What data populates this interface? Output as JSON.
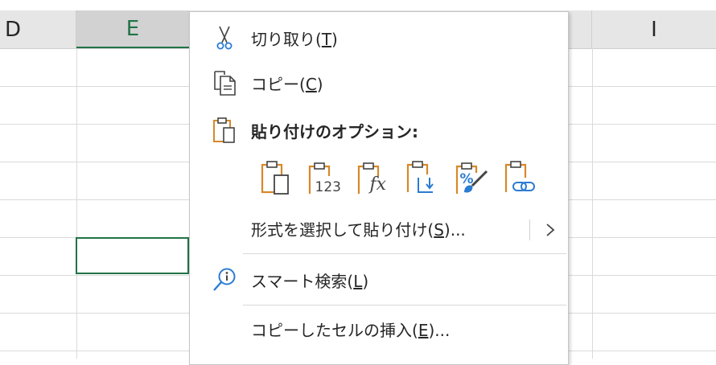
{
  "sheet": {
    "columns": [
      "D",
      "E",
      "",
      "",
      "I"
    ],
    "selected_column": "E"
  },
  "menu": {
    "cut": {
      "label_main": "切り取り(",
      "accel": "T",
      "label_end": ")"
    },
    "copy": {
      "label_main": "コピー(",
      "accel": "C",
      "label_end": ")"
    },
    "paste_options_title": "貼り付けのオプション:",
    "paste_options": [
      {
        "name": "paste-default",
        "icon": "clipboard-page-icon"
      },
      {
        "name": "paste-values",
        "icon": "clipboard-123-icon",
        "text": "123"
      },
      {
        "name": "paste-formulas",
        "icon": "clipboard-fx-icon",
        "text": "fx"
      },
      {
        "name": "paste-transpose",
        "icon": "clipboard-transpose-icon"
      },
      {
        "name": "paste-formatting",
        "icon": "clipboard-brush-icon",
        "text": "%"
      },
      {
        "name": "paste-link",
        "icon": "clipboard-link-icon"
      }
    ],
    "paste_special": {
      "label_main": "形式を選択して貼り付け(",
      "accel": "S",
      "label_end": ")..."
    },
    "smart_lookup": {
      "label_main": "スマート検索(",
      "accel": "L",
      "label_end": ")"
    },
    "insert_copied": {
      "label_main": "コピーしたセルの挿入(",
      "accel": "E",
      "label_end": ")..."
    }
  },
  "colors": {
    "accent_green": "#217346",
    "clip_orange": "#d7882a",
    "icon_blue": "#2b7cd3"
  }
}
